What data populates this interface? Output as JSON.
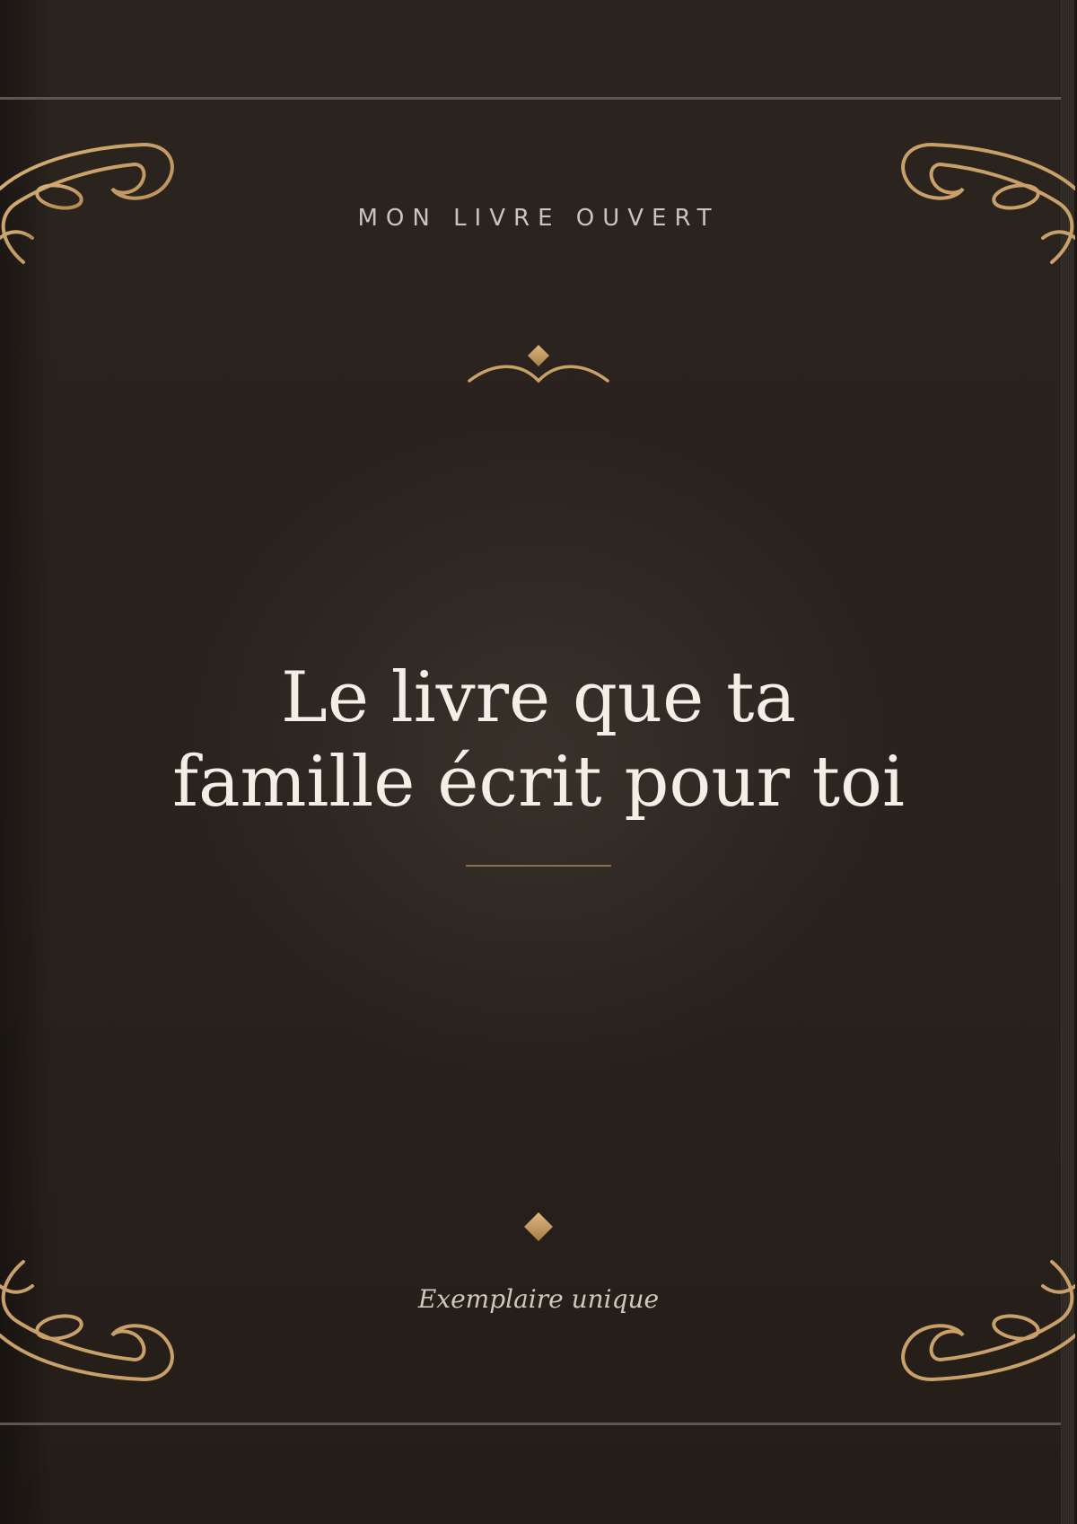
{
  "cover": {
    "brand": "MON LIVRE OUVERT",
    "title_lines": [
      "Le livre que ta",
      "famille écrit pour toi"
    ],
    "edition": "Exemplaire unique"
  },
  "icons": {
    "corner": "flourish-ornament-icon",
    "crest": "crest-ornament-icon",
    "diamond": "diamond-ornament-icon"
  },
  "colors": {
    "background": "#29221d",
    "gold": "#c9a06a",
    "text": "#f3eee6",
    "rule": "#5d5750"
  }
}
